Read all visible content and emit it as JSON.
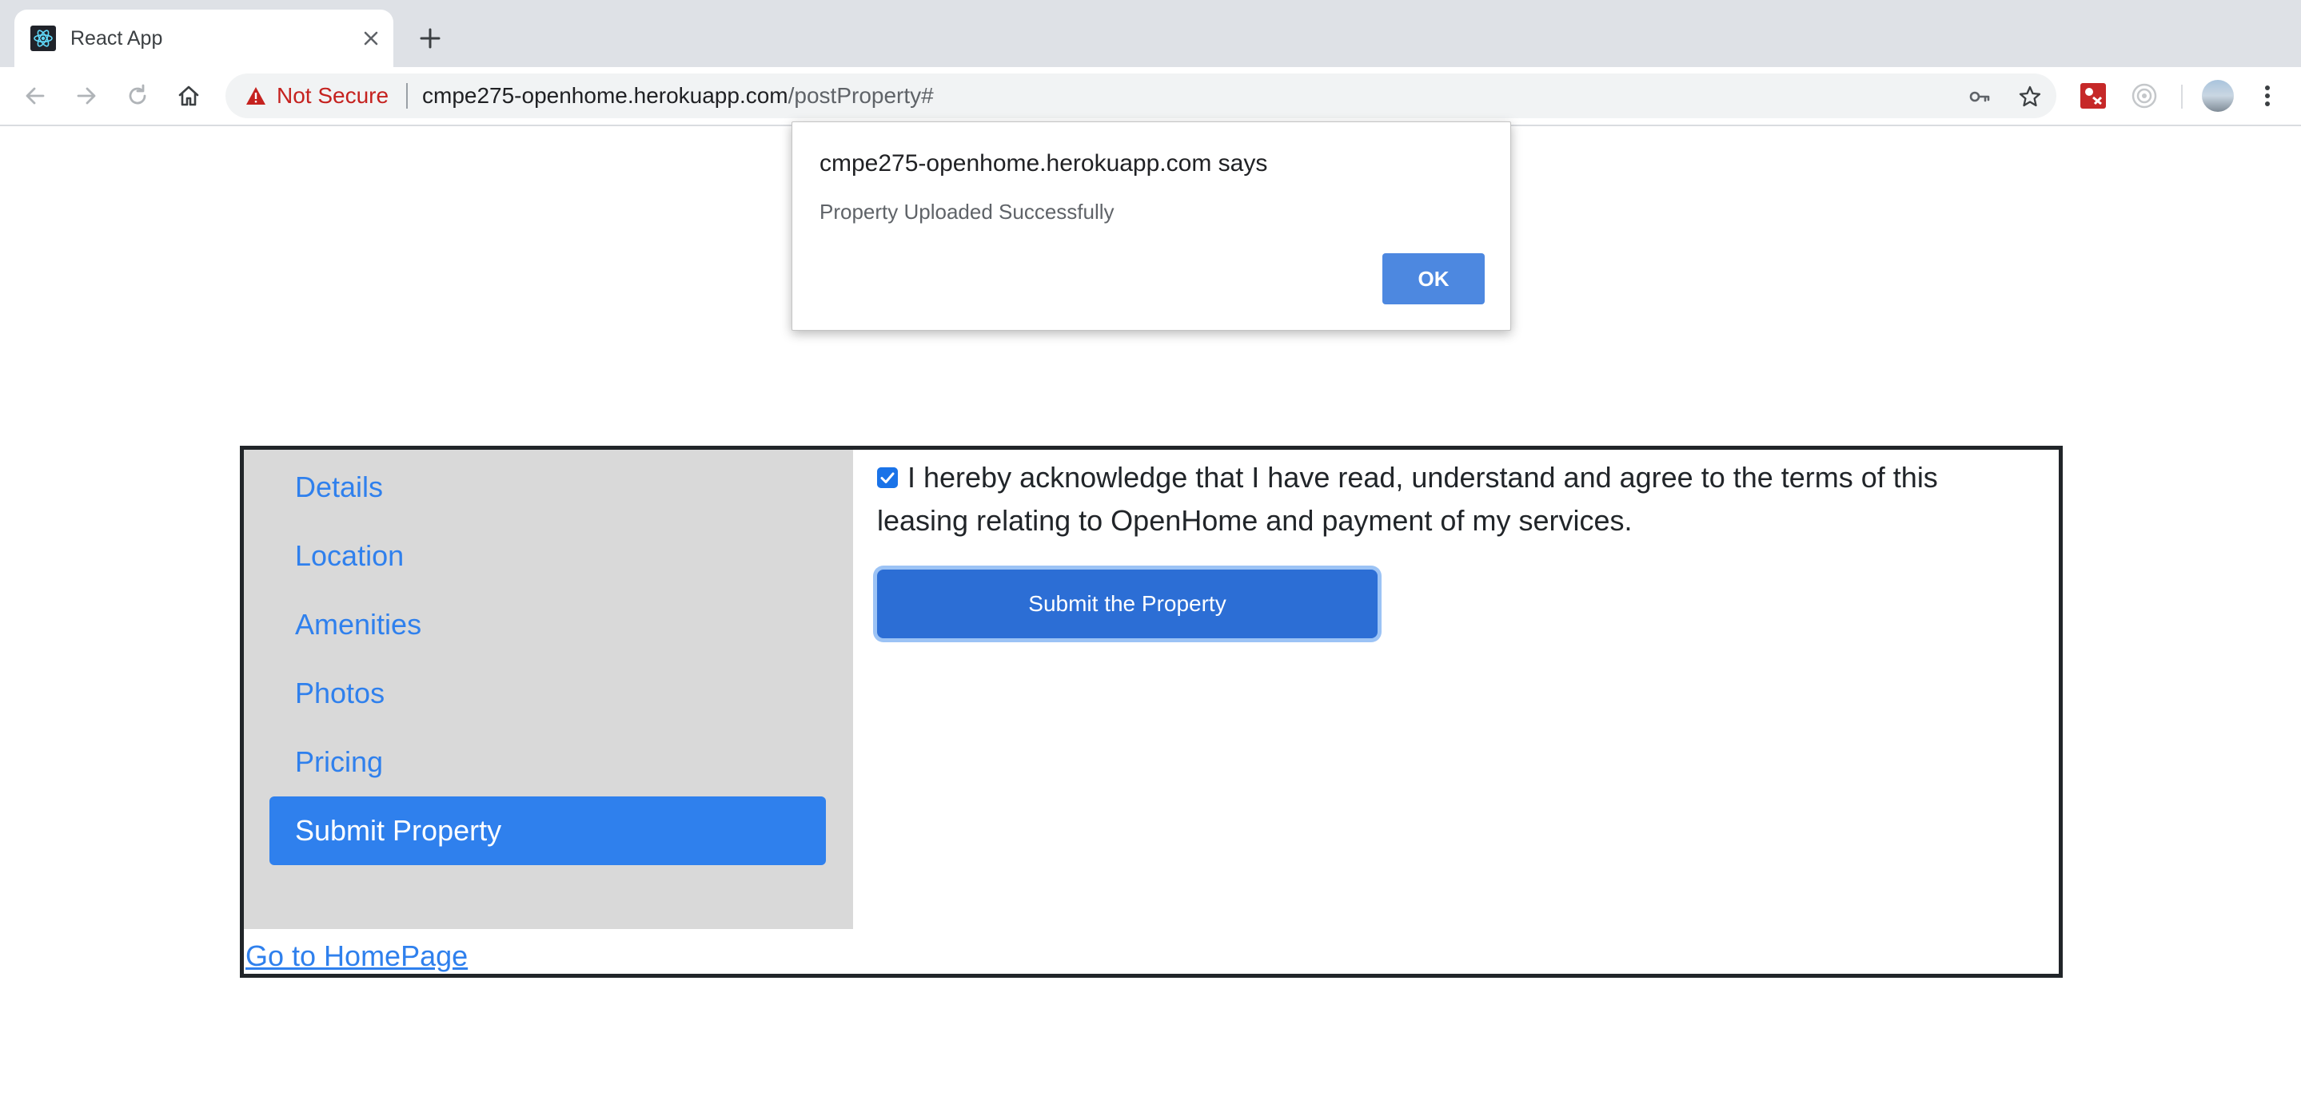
{
  "browser": {
    "tab_title": "React App",
    "tab_favicon": "react-atom-icon",
    "security_label": "Not Secure",
    "url_host": "cmpe275-openhome.herokuapp.com",
    "url_path": "/postProperty#",
    "security_color": "#c5221f"
  },
  "sidebar": {
    "items": [
      {
        "label": "Details"
      },
      {
        "label": "Location"
      },
      {
        "label": "Amenities"
      },
      {
        "label": "Photos"
      },
      {
        "label": "Pricing"
      },
      {
        "label": "Submit Property"
      }
    ],
    "active_item": "Submit Property",
    "accent_color": "#2f80ed"
  },
  "content": {
    "ack_checked": true,
    "ack_text": "I hereby acknowledge that I have read, understand and agree to the terms of this leasing relating to OpenHome and payment of my services.",
    "submit_label": "Submit the Property"
  },
  "footer": {
    "home_link": "Go to HomePage"
  },
  "dialog": {
    "title": "cmpe275-openhome.herokuapp.com says",
    "message": "Property Uploaded Successfully",
    "ok_label": "OK"
  }
}
